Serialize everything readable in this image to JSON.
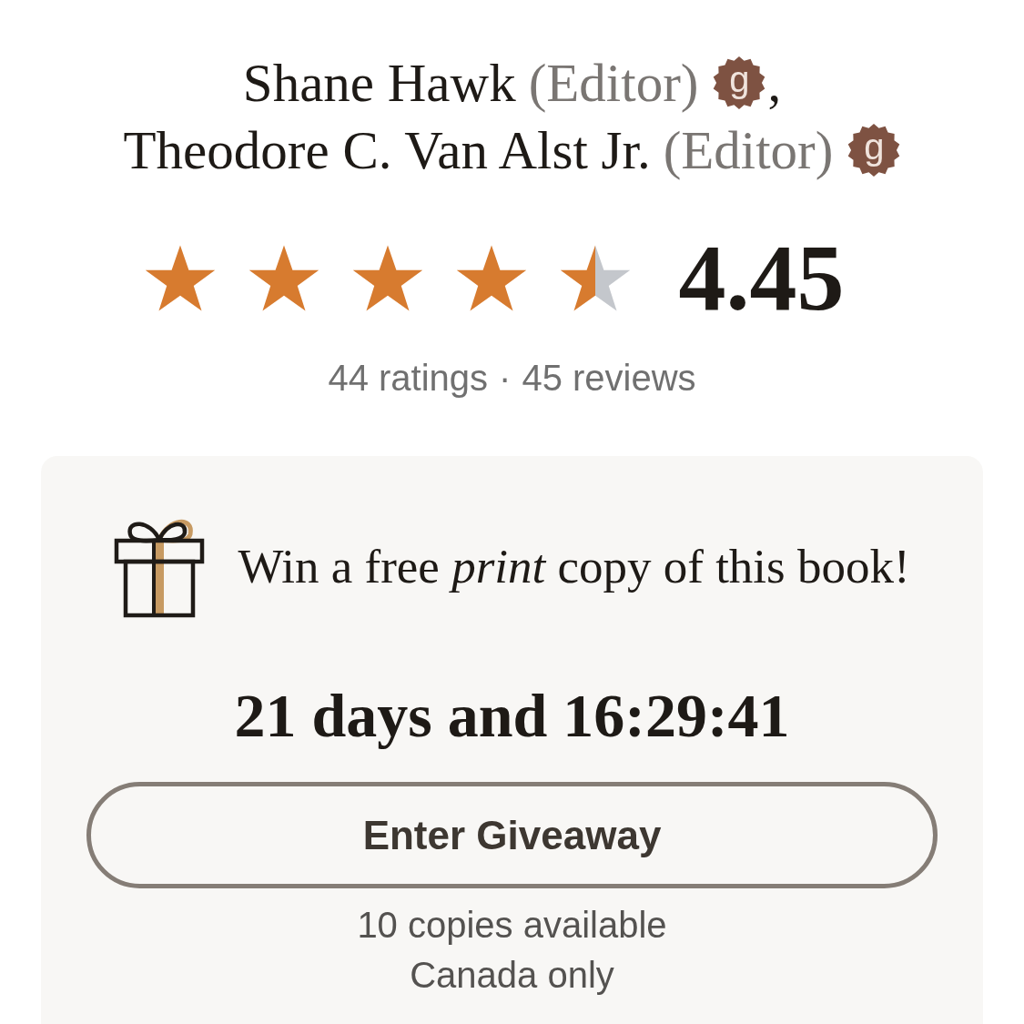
{
  "authors": [
    {
      "name": "Shane Hawk",
      "role": "(Editor)",
      "badge": "g",
      "separator": ","
    },
    {
      "name": "Theodore C. Van Alst Jr.",
      "role": "(Editor)",
      "badge": "g"
    }
  ],
  "rating": {
    "stars": 4.5,
    "value": "4.45",
    "ratings": "44 ratings",
    "separator": "·",
    "reviews": "45 reviews"
  },
  "giveaway": {
    "headline": "Win a free *print* copy of this book!",
    "countdown": "21 days and 16:29:41",
    "button": "Enter Giveaway",
    "details": [
      "10 copies available",
      "Canada only"
    ]
  }
}
